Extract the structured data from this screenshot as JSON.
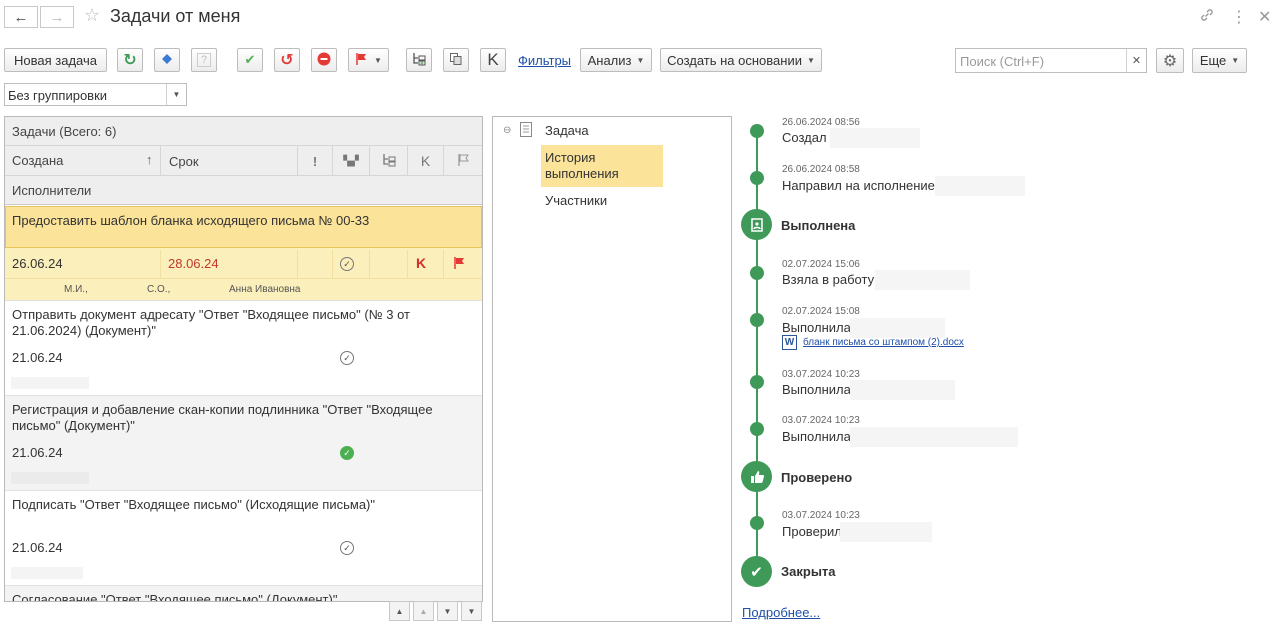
{
  "window": {
    "title": "Задачи от меня",
    "back_icon": "←",
    "forward_icon": "→"
  },
  "toolbar": {
    "new_task": "Новая задача",
    "filters": "Фильтры",
    "analysis": "Анализ",
    "create_based": "Создать на основании",
    "k_label": "K",
    "more": "Еще"
  },
  "search": {
    "placeholder": "Поиск (Ctrl+F)"
  },
  "grouping": {
    "value": "Без группировки"
  },
  "table": {
    "header_title": "Задачи (Всего: 6)",
    "col_created": "Создана",
    "col_deadline": "Срок",
    "col_executors": "Исполнители",
    "rows": [
      {
        "title": "Предоставить шаблон бланка исходящего письма № 00-33",
        "created": "26.06.24",
        "deadline": "28.06.24",
        "k": "K",
        "executors": [
          "М.И.,",
          "С.О.,",
          "Анна Ивановна"
        ]
      },
      {
        "title": "Отправить документ адресату \"Ответ \"Входящее письмо\" (№ 3 от 21.06.2024) (Документ)\"",
        "created": "21.06.24"
      },
      {
        "title": "Регистрация и добавление скан-копии подлинника \"Ответ \"Входящее письмо\" (Документ)\"",
        "created": "21.06.24"
      },
      {
        "title": "Подписать \"Ответ \"Входящее письмо\" (Исходящие письма)\"",
        "created": "21.06.24"
      },
      {
        "title": "Согласование \"Ответ \"Входящее письмо\" (Документ)\""
      }
    ]
  },
  "tree": {
    "root": "Задача",
    "history": "История выполнения",
    "participants": "Участники"
  },
  "timeline": {
    "events": [
      {
        "date": "26.06.2024 08:56",
        "text": "Создал"
      },
      {
        "date": "26.06.2024 08:58",
        "text": "Направил на исполнение"
      },
      {
        "status": "Выполнена"
      },
      {
        "date": "02.07.2024 15:06",
        "text": "Взяла в работу"
      },
      {
        "date": "02.07.2024 15:08",
        "text": "Выполнила",
        "attachment": "бланк письма со штампом (2).docx"
      },
      {
        "date": "03.07.2024 10:23",
        "text": "Выполнила"
      },
      {
        "date": "03.07.2024 10:23",
        "text": "Выполнила"
      },
      {
        "status": "Проверено"
      },
      {
        "date": "03.07.2024 10:23",
        "text": "Проверил"
      },
      {
        "status": "Закрыта"
      }
    ],
    "more_link": "Подробнее..."
  },
  "colors": {
    "accent_green": "#3f9a59",
    "selection": "#fbefbc",
    "deadline_red": "#c0392b",
    "link_blue": "#1f4fa8"
  }
}
